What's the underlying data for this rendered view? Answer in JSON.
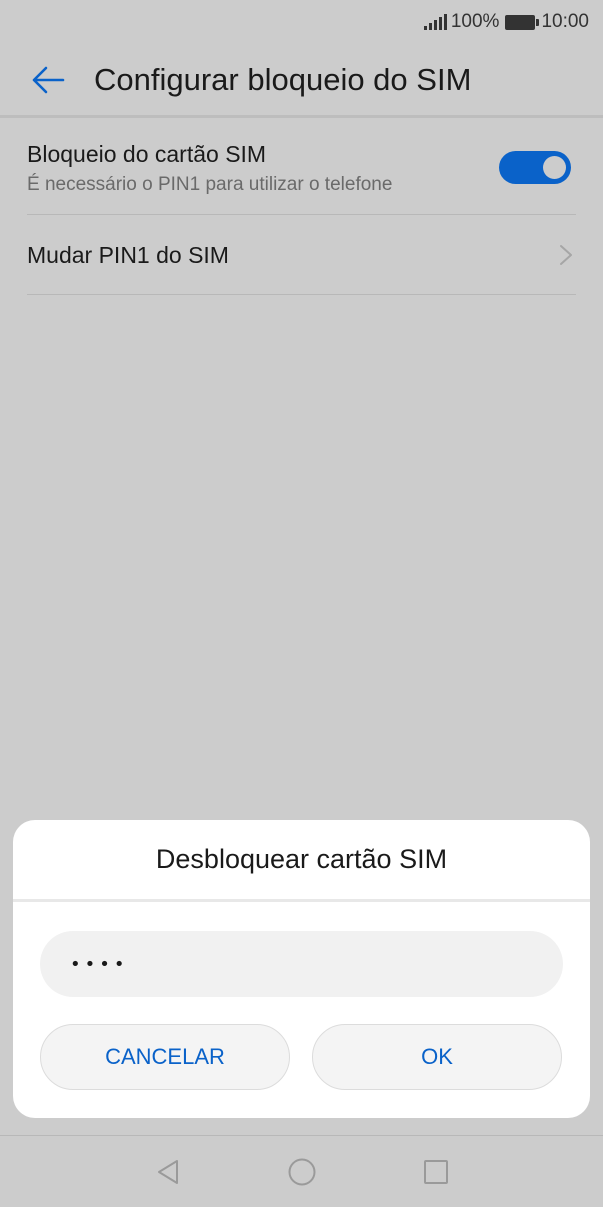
{
  "status_bar": {
    "battery_percent": "100%",
    "time": "10:00",
    "signal_icon": "signal-icon",
    "battery_icon": "battery-icon"
  },
  "app_bar": {
    "back_icon": "arrow-left-icon",
    "title": "Configurar bloqueio do SIM"
  },
  "settings": {
    "sim_lock": {
      "title": "Bloqueio do cartão SIM",
      "subtitle": "É necessário o PIN1 para utilizar o telefone",
      "enabled": true
    },
    "change_pin": {
      "title": "Mudar PIN1 do SIM",
      "icon": "chevron-right-icon"
    }
  },
  "dialog": {
    "title": "Desbloquear cartão SIM",
    "pin_value": "••••",
    "cancel_label": "CANCELAR",
    "ok_label": "OK"
  },
  "nav_bar": {
    "icons": [
      "back-triangle-icon",
      "home-circle-icon",
      "recents-square-icon"
    ]
  },
  "colors": {
    "accent": "#0a62c9",
    "background": "#cccccc",
    "dialog": "#ffffff"
  }
}
